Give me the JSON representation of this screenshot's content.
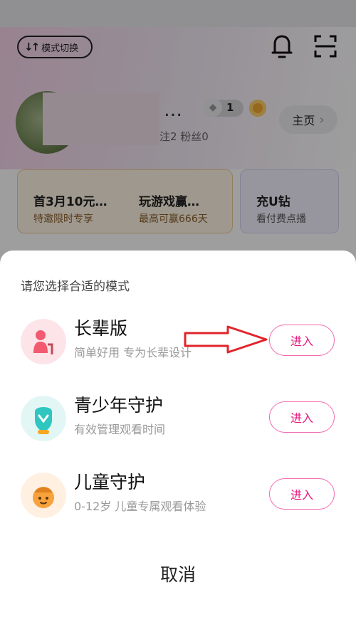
{
  "background": {
    "mode_switch_label": "模式切换",
    "user_stats": "注2  粉丝0",
    "diamond_count": "1",
    "home_button_label": "主页",
    "promo_cards": [
      {
        "title": "首3月10元…",
        "subtitle": "特邀限时专享"
      },
      {
        "title": "玩游戏赢…",
        "subtitle": "最高可赢666天"
      },
      {
        "title": "充U钻",
        "subtitle": "看付费点播"
      }
    ]
  },
  "sheet": {
    "title": "请您选择合适的模式",
    "modes": [
      {
        "name": "长辈版",
        "desc": "简单好用 专为长辈设计",
        "button": "进入",
        "icon": "elder-icon"
      },
      {
        "name": "青少年守护",
        "desc": "有效管理观看时间",
        "button": "进入",
        "icon": "teen-icon"
      },
      {
        "name": "儿童守护",
        "desc": "0-12岁 儿童专属观看体验",
        "button": "进入",
        "icon": "child-icon"
      }
    ],
    "cancel_label": "取消"
  },
  "colors": {
    "accent": "#e8197d",
    "button_border": "#f06ab0",
    "annotation_arrow": "#e0242a"
  }
}
